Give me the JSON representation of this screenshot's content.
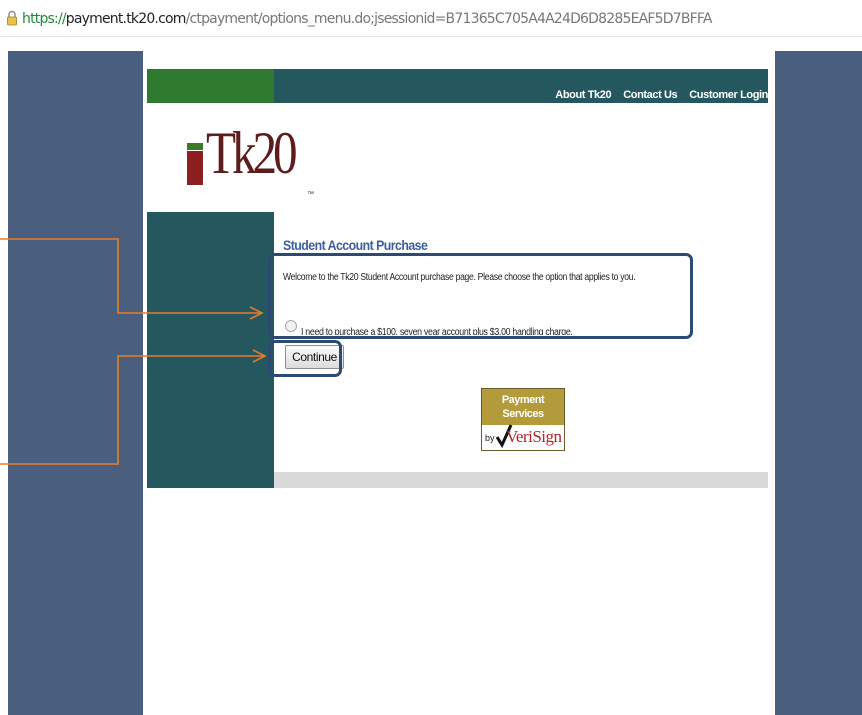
{
  "browser": {
    "url_protocol": "https://",
    "url_host": "payment.tk20.com",
    "url_path": "/ctpayment/options_menu.do;jsessionid=B71365C705A4A24D6D8285EAF5D7BFFA"
  },
  "nav": {
    "about": "About Tk20",
    "contact": "Contact Us",
    "login": "Customer Login"
  },
  "logo": {
    "text": "Tk20",
    "tm": "™"
  },
  "content": {
    "heading": "Student Account Purchase",
    "welcome": "Welcome to the Tk20 Student Account purchase page. Please choose the option that applies to you.",
    "option_label": "I need to purchase a $100, seven year account plus $3.00 handling charge.",
    "continue_label": "Continue"
  },
  "seal": {
    "line1": "Payment Services",
    "by": "by",
    "brand": "VeriSign"
  },
  "colors": {
    "side_background": "#4a5f7e",
    "teal": "#25575f",
    "green": "#2e7a2e",
    "heading": "#3c5e9c",
    "annotation_box": "#2c4b73",
    "annotation_arrow": "#e87d2a"
  }
}
